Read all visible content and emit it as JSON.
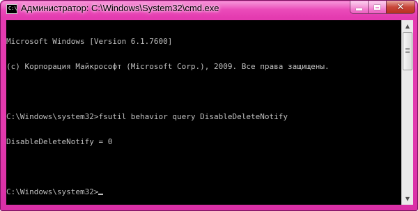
{
  "window": {
    "title": "Администратор: C:\\Windows\\System32\\cmd.exe",
    "app_icon_text": "C:\\",
    "accent_color": "#e23aae",
    "close_button_color": "#c9473a"
  },
  "caption_buttons": {
    "minimize_icon": "minimize-icon",
    "maximize_icon": "maximize-icon",
    "close_icon": "close-icon",
    "close_glyph": "✕"
  },
  "console": {
    "background_color": "#000000",
    "text_color": "#c0c0c0",
    "lines": [
      "Microsoft Windows [Version 6.1.7600]",
      "(c) Корпорация Майкрософт (Microsoft Corp.), 2009. Все права защищены.",
      "",
      "C:\\Windows\\system32>fsutil behavior query DisableDeleteNotify",
      "DisableDeleteNotify = 0",
      "",
      "C:\\Windows\\system32>"
    ]
  },
  "scrollbar": {
    "up_arrow": "▲",
    "down_arrow": "▼",
    "position_fraction": 0.0
  }
}
